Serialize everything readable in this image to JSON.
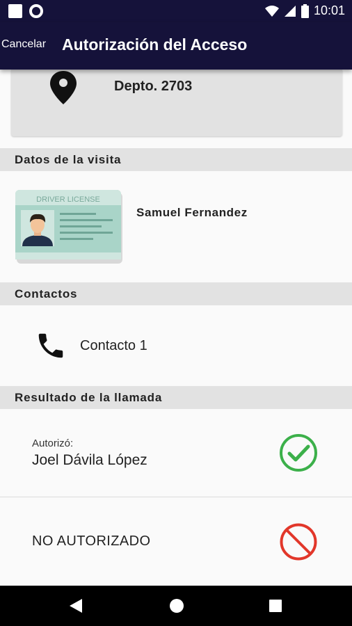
{
  "status_bar": {
    "time": "10:01"
  },
  "app_bar": {
    "cancel_label": "Cancelar",
    "title": "Autorización del Acceso"
  },
  "destination": {
    "unit": "Depto. 2703"
  },
  "visit_section": {
    "header": "Datos de la visita",
    "license_text": "DRIVER LICENSE",
    "visitor_name": "Samuel Fernandez"
  },
  "contacts_section": {
    "header": "Contactos",
    "items": [
      {
        "label": "Contacto 1",
        "icon": "phone-icon"
      }
    ]
  },
  "call_result_section": {
    "header": "Resultado de la llamada",
    "authorized_label": "Autorizó:",
    "authorized_name": "Joel Dávila López",
    "not_authorized_label": "NO AUTORIZADO"
  },
  "colors": {
    "primary": "#15123a",
    "success": "#3cb04a",
    "danger": "#e2372a",
    "section_bg": "#e2e2e2"
  }
}
